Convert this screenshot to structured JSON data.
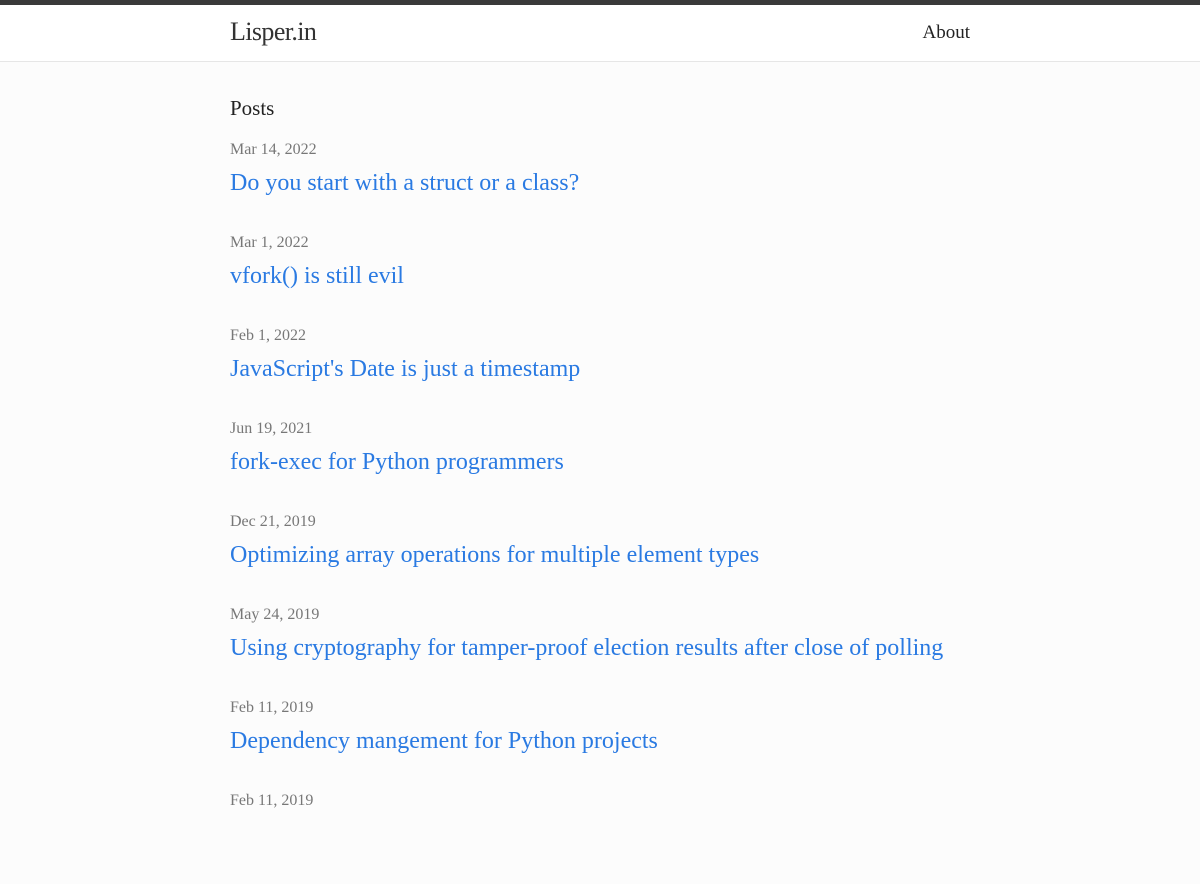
{
  "site": {
    "title": "Lisper.in"
  },
  "nav": {
    "about_label": "About"
  },
  "main": {
    "section_title": "Posts",
    "posts": [
      {
        "date": "Mar 14, 2022",
        "title": "Do you start with a struct or a class?"
      },
      {
        "date": "Mar 1, 2022",
        "title": "vfork() is still evil"
      },
      {
        "date": "Feb 1, 2022",
        "title": "JavaScript's Date is just a timestamp"
      },
      {
        "date": "Jun 19, 2021",
        "title": "fork-exec for Python programmers"
      },
      {
        "date": "Dec 21, 2019",
        "title": "Optimizing array operations for multiple element types"
      },
      {
        "date": "May 24, 2019",
        "title": "Using cryptography for tamper-proof election results after close of polling"
      },
      {
        "date": "Feb 11, 2019",
        "title": "Dependency mangement for Python projects"
      },
      {
        "date": "Feb 11, 2019",
        "title": ""
      }
    ]
  },
  "colors": {
    "link": "#2a7ae2",
    "date": "#777777",
    "top_bar": "#3a3a3a",
    "background": "#fcfcfc"
  }
}
